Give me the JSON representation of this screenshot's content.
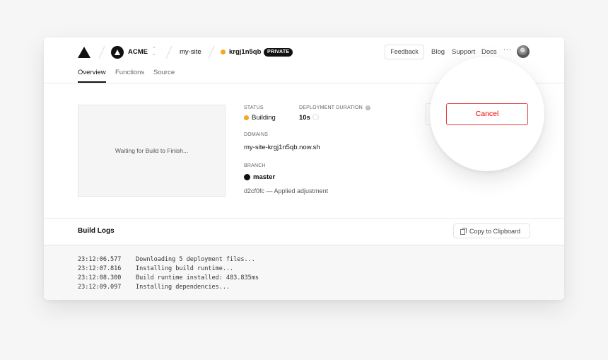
{
  "header": {
    "team": "ACME",
    "project": "my-site",
    "deployment_id": "krgj1n5qb",
    "visibility_badge": "PRIVATE",
    "status_dot_color": "#f5a623",
    "feedback_label": "Feedback",
    "nav": [
      "Blog",
      "Support",
      "Docs"
    ],
    "more_label": "···"
  },
  "tabs": [
    "Overview",
    "Functions",
    "Source"
  ],
  "preview": {
    "text": "Waiting for Build to Finish..."
  },
  "details": {
    "status_label": "STATUS",
    "status_value": "Building",
    "duration_label": "DEPLOYMENT DURATION",
    "duration_value": "10s",
    "domains_label": "DOMAINS",
    "domain": "my-site-krgj1n5qb.now.sh",
    "branch_label": "BRANCH",
    "branch": "master",
    "commit": "d2cf0fc — Applied adjustment"
  },
  "actions": {
    "cancel_label": "Cancel",
    "cancel_color": "#e00000"
  },
  "build_logs": {
    "title": "Build Logs",
    "copy_label": "Copy to Clipboard",
    "lines": [
      {
        "time": "23:12:06.577",
        "message": "Downloading 5 deployment files..."
      },
      {
        "time": "23:12:07.816",
        "message": "Installing build runtime..."
      },
      {
        "time": "23:12:08.300",
        "message": "Build runtime installed: 483.835ms"
      },
      {
        "time": "23:12:09.097",
        "message": "Installing dependencies..."
      }
    ]
  },
  "icons": [
    "triangle-logo-icon",
    "team-logo-icon",
    "updown-chevron-icon",
    "info-icon",
    "spinner-icon",
    "github-icon",
    "copy-icon",
    "user-avatar"
  ]
}
